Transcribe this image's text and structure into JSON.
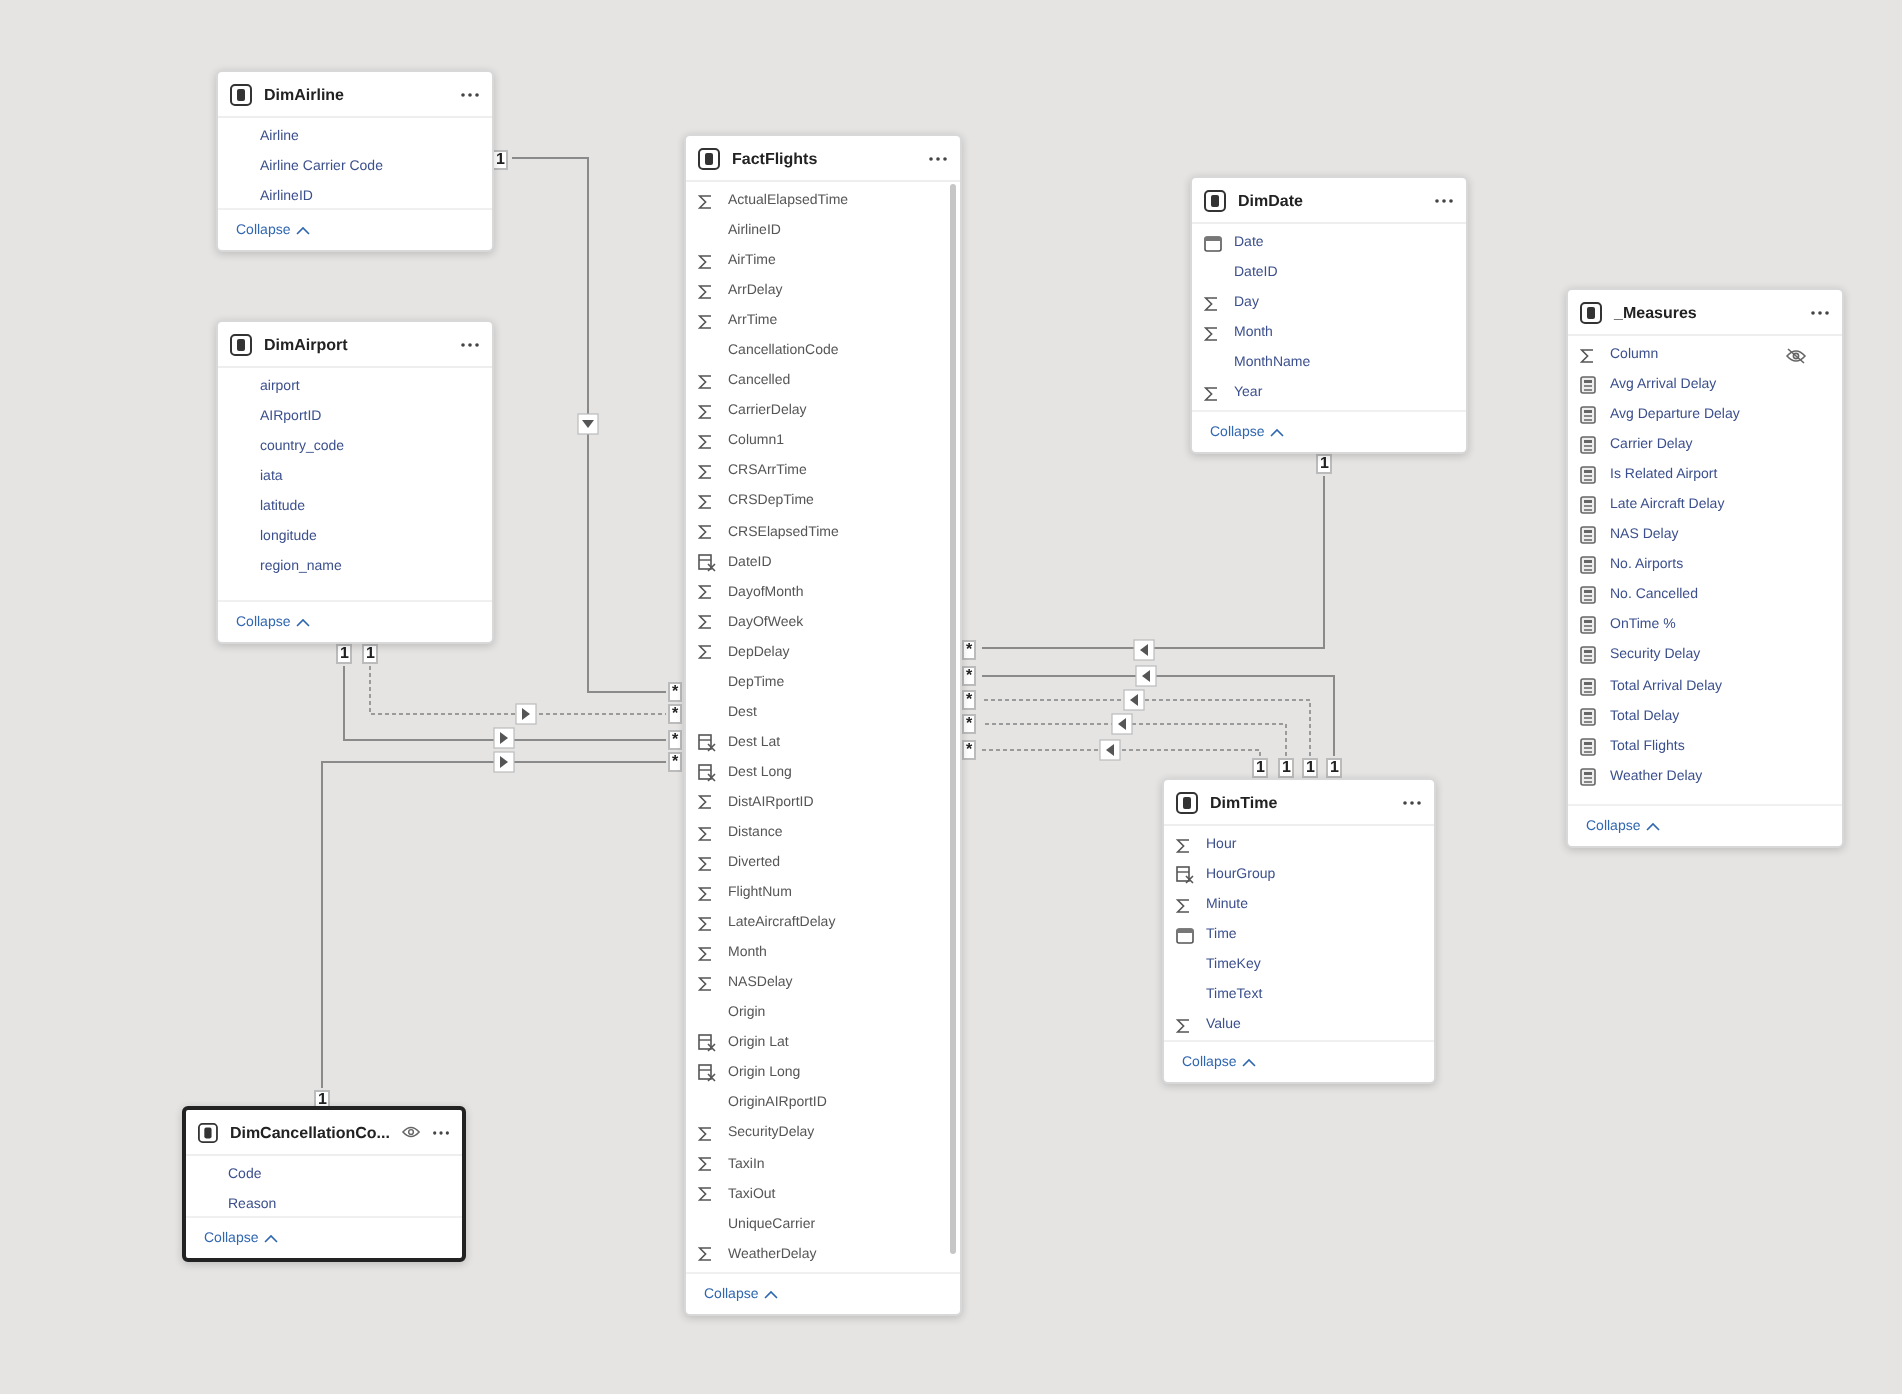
{
  "tables": [
    {
      "title": "DimAirline",
      "related": true,
      "selected": false,
      "visibility_icon": false,
      "collapse": "Collapse",
      "fields": [
        {
          "name": "Airline",
          "kind": "none"
        },
        {
          "name": "Airline Carrier Code",
          "kind": "none"
        },
        {
          "name": "AirlineID",
          "kind": "none"
        }
      ]
    },
    {
      "title": "DimAirport",
      "related": true,
      "selected": false,
      "visibility_icon": false,
      "collapse": "Collapse",
      "fields": [
        {
          "name": "airport",
          "kind": "none"
        },
        {
          "name": "AIRportID",
          "kind": "none"
        },
        {
          "name": "country_code",
          "kind": "none"
        },
        {
          "name": "iata",
          "kind": "none"
        },
        {
          "name": "latitude",
          "kind": "none"
        },
        {
          "name": "longitude",
          "kind": "none"
        },
        {
          "name": "region_name",
          "kind": "none"
        }
      ]
    },
    {
      "title": "FactFlights",
      "related": false,
      "selected": false,
      "visibility_icon": false,
      "collapse": "Collapse",
      "fields": [
        {
          "name": "ActualElapsedTime",
          "kind": "sum"
        },
        {
          "name": "AirlineID",
          "kind": "none"
        },
        {
          "name": "AirTime",
          "kind": "sum"
        },
        {
          "name": "ArrDelay",
          "kind": "sum"
        },
        {
          "name": "ArrTime",
          "kind": "sum"
        },
        {
          "name": "CancellationCode",
          "kind": "none"
        },
        {
          "name": "Cancelled",
          "kind": "sum"
        },
        {
          "name": "CarrierDelay",
          "kind": "sum"
        },
        {
          "name": "Column1",
          "kind": "sum"
        },
        {
          "name": "CRSArrTime",
          "kind": "sum"
        },
        {
          "name": "CRSDepTime",
          "kind": "sum"
        },
        {
          "name": "CRSElapsedTime",
          "kind": "sum"
        },
        {
          "name": "DateID",
          "kind": "calc"
        },
        {
          "name": "DayofMonth",
          "kind": "sum"
        },
        {
          "name": "DayOfWeek",
          "kind": "sum"
        },
        {
          "name": "DepDelay",
          "kind": "sum"
        },
        {
          "name": "DepTime",
          "kind": "none"
        },
        {
          "name": "Dest",
          "kind": "none"
        },
        {
          "name": "Dest Lat",
          "kind": "calc"
        },
        {
          "name": "Dest Long",
          "kind": "calc"
        },
        {
          "name": "DistAIRportID",
          "kind": "sum"
        },
        {
          "name": "Distance",
          "kind": "sum"
        },
        {
          "name": "Diverted",
          "kind": "sum"
        },
        {
          "name": "FlightNum",
          "kind": "sum"
        },
        {
          "name": "LateAircraftDelay",
          "kind": "sum"
        },
        {
          "name": "Month",
          "kind": "sum"
        },
        {
          "name": "NASDelay",
          "kind": "sum"
        },
        {
          "name": "Origin",
          "kind": "none"
        },
        {
          "name": "Origin Lat",
          "kind": "calc"
        },
        {
          "name": "Origin Long",
          "kind": "calc"
        },
        {
          "name": "OriginAIRportID",
          "kind": "none"
        },
        {
          "name": "SecurityDelay",
          "kind": "sum"
        },
        {
          "name": "TaxiIn",
          "kind": "sum"
        },
        {
          "name": "TaxiOut",
          "kind": "sum"
        },
        {
          "name": "UniqueCarrier",
          "kind": "none"
        },
        {
          "name": "WeatherDelay",
          "kind": "sum"
        }
      ]
    },
    {
      "title": "DimDate",
      "related": true,
      "selected": false,
      "visibility_icon": false,
      "collapse": "Collapse",
      "fields": [
        {
          "name": "Date",
          "kind": "date"
        },
        {
          "name": "DateID",
          "kind": "none"
        },
        {
          "name": "Day",
          "kind": "sum"
        },
        {
          "name": "Month",
          "kind": "sum"
        },
        {
          "name": "MonthName",
          "kind": "none"
        },
        {
          "name": "Year",
          "kind": "sum"
        }
      ]
    },
    {
      "title": "_Measures",
      "related": true,
      "selected": false,
      "visibility_icon": false,
      "collapse": "Collapse",
      "fields": [
        {
          "name": "Column",
          "kind": "sum",
          "hidden": true
        },
        {
          "name": "Avg Arrival Delay",
          "kind": "measure"
        },
        {
          "name": "Avg Departure Delay",
          "kind": "measure"
        },
        {
          "name": "Carrier Delay",
          "kind": "measure"
        },
        {
          "name": "Is Related Airport",
          "kind": "measure"
        },
        {
          "name": "Late Aircraft Delay",
          "kind": "measure"
        },
        {
          "name": "NAS Delay",
          "kind": "measure"
        },
        {
          "name": "No. Airports",
          "kind": "measure"
        },
        {
          "name": "No. Cancelled",
          "kind": "measure"
        },
        {
          "name": "OnTime %",
          "kind": "measure"
        },
        {
          "name": "Security Delay",
          "kind": "measure"
        },
        {
          "name": "Total Arrival Delay",
          "kind": "measure"
        },
        {
          "name": "Total Delay",
          "kind": "measure"
        },
        {
          "name": "Total Flights",
          "kind": "measure"
        },
        {
          "name": "Weather Delay",
          "kind": "measure"
        }
      ]
    },
    {
      "title": "DimTime",
      "related": true,
      "selected": false,
      "visibility_icon": false,
      "collapse": "Collapse",
      "fields": [
        {
          "name": "Hour",
          "kind": "sum"
        },
        {
          "name": "HourGroup",
          "kind": "calc"
        },
        {
          "name": "Minute",
          "kind": "sum"
        },
        {
          "name": "Time",
          "kind": "date"
        },
        {
          "name": "TimeKey",
          "kind": "none"
        },
        {
          "name": "TimeText",
          "kind": "none"
        },
        {
          "name": "Value",
          "kind": "sum"
        }
      ]
    },
    {
      "title": "DimCancellationCo...",
      "related": true,
      "selected": true,
      "visibility_icon": true,
      "collapse": "Collapse",
      "fields": [
        {
          "name": "Code",
          "kind": "none"
        },
        {
          "name": "Reason",
          "kind": "none"
        }
      ]
    }
  ],
  "relationships": [
    {
      "active": true
    },
    {
      "active": false
    },
    {
      "active": true
    },
    {
      "active": true
    },
    {
      "active": true
    },
    {
      "active": false
    },
    {
      "active": false
    },
    {
      "active": false
    },
    {
      "active": true
    }
  ],
  "one_labels": [
    "1",
    "1",
    "1",
    "1",
    "1",
    "1",
    "1",
    "1",
    "1"
  ],
  "many_labels": [
    "*",
    "*",
    "*",
    "*",
    "*",
    "*",
    "*",
    "*",
    "*"
  ]
}
